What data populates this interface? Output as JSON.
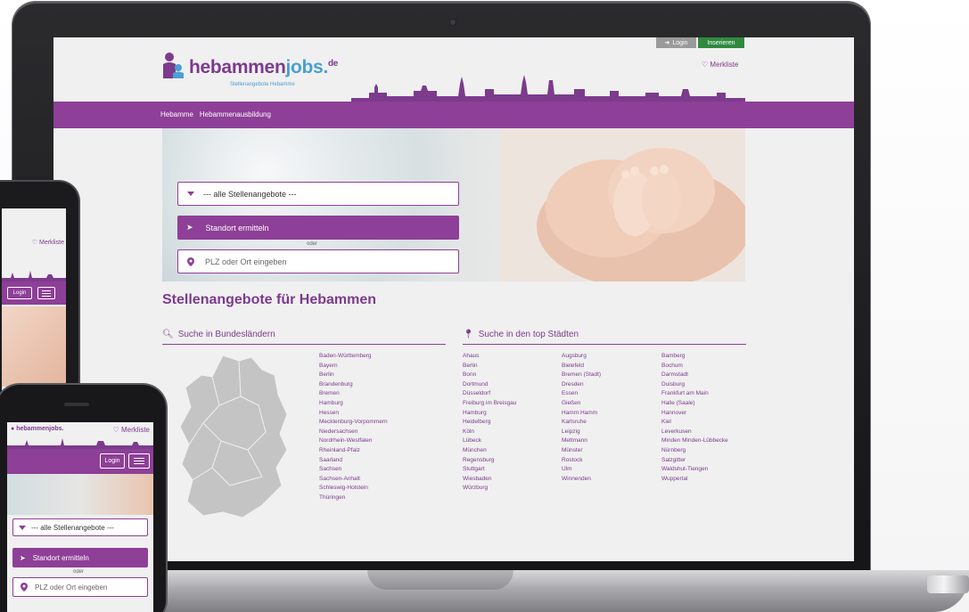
{
  "site": {
    "logo_main": "hebammen",
    "logo_accent": "jobs.",
    "logo_tld": "de",
    "logo_tagline": "Stellenangebote Hebamme",
    "login_label": "Login",
    "insert_label": "Inserieren",
    "merkliste_label": "Merkliste",
    "nav": [
      "Hebamme",
      "Hebammenausbildung"
    ],
    "select_label": "--- alle Stellenangebote ---",
    "locate_label": "Standort ermitteln",
    "oder_label": "oder",
    "plz_placeholder": "PLZ oder Ort eingeben",
    "page_title": "Stellenangebote für Hebammen",
    "section_states": "Suche in Bundesländern",
    "section_cities": "Suche in den top Städten",
    "states": [
      "Baden-Württemberg",
      "Bayern",
      "Berlin",
      "Brandenburg",
      "Bremen",
      "Hamburg",
      "Hessen",
      "Mecklenburg-Vorpommern",
      "Niedersachsen",
      "Nordrhein-Westfalen",
      "Rheinland-Pfalz",
      "Saarland",
      "Sachsen",
      "Sachsen-Anhalt",
      "Schleswig-Holstein",
      "Thüringen"
    ],
    "cities_col1": [
      "Ahaus",
      "Berlin",
      "Bonn",
      "Dortmund",
      "Düsseldorf",
      "Freiburg im Breisgau",
      "Hamburg",
      "Heidelberg",
      "Köln",
      "Lübeck",
      "München",
      "Regensburg",
      "Stuttgart",
      "Wiesbaden",
      "Würzburg"
    ],
    "cities_col2": [
      "Augsburg",
      "Bielefeld",
      "Bremen (Stadt)",
      "Dresden",
      "Essen",
      "Gießen",
      "Hamm Hamm",
      "Karlsruhe",
      "Leipzig",
      "Mettmann",
      "Münster",
      "Rostock",
      "Ulm",
      "Winnenden"
    ],
    "cities_col3": [
      "Bamberg",
      "Bochum",
      "Darmstadt",
      "Duisburg",
      "Frankfurt am Main",
      "Halle (Saale)",
      "Hannover",
      "Kiel",
      "Leverkusen",
      "Minden Minden-Lübbecke",
      "Nürnberg",
      "Salzgitter",
      "Waldshut-Tiengen",
      "Wuppertal"
    ]
  },
  "phone_front": {
    "logo": "hebammenjobs.",
    "merkliste_label": "Merkliste",
    "login_label": "Login",
    "select_label": "--- alle Stellenangebote ---",
    "locate_label": "Standort ermitteln",
    "oder_label": "oder",
    "plz_placeholder": "PLZ oder Ort eingeben"
  },
  "phone_back": {
    "merkliste_label": "Merkliste",
    "login_label": "Login"
  },
  "colors": {
    "brand_purple": "#8e3f97",
    "brand_blue": "#4b9fd1",
    "insert_green": "#2f8a3e"
  }
}
